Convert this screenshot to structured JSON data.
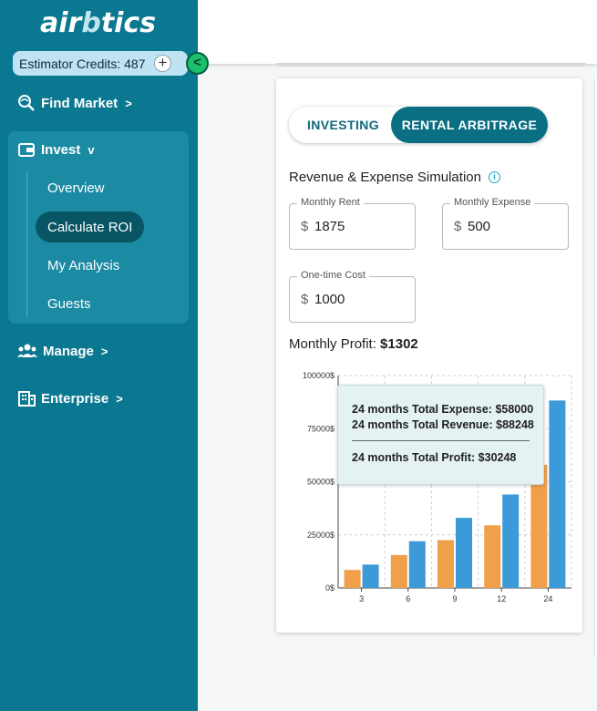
{
  "brand": {
    "logo_prefix": "air",
    "logo_mid": "b",
    "logo_suffix": "tics"
  },
  "credits": {
    "label": "Estimator Credits: 487"
  },
  "sidebar": {
    "find_market": "Find Market",
    "invest": "Invest",
    "invest_items": [
      "Overview",
      "Calculate ROI",
      "My Analysis",
      "Guests"
    ],
    "manage": "Manage",
    "enterprise": "Enterprise"
  },
  "toggle": {
    "investing": "INVESTING",
    "rental": "RENTAL ARBITRAGE"
  },
  "simulation": {
    "title": "Revenue & Expense Simulation",
    "currency": "$",
    "monthly_rent": {
      "label": "Monthly Rent",
      "value": "1875"
    },
    "monthly_expense": {
      "label": "Monthly Expense",
      "value": "500"
    },
    "one_time_cost": {
      "label": "One-time Cost",
      "value": "1000"
    }
  },
  "profit": {
    "label": "Monthly Profit:",
    "value": "$1302"
  },
  "tooltip": {
    "expense": "24 months Total Expense: $58000",
    "revenue": "24 months Total Revenue: $88248",
    "profit": "24 months Total Profit: $30248"
  },
  "colors": {
    "expense": "#f0a04b",
    "revenue": "#3d9ad8",
    "sidebar": "#0b7891",
    "accent": "#0b6f84"
  },
  "chart_data": {
    "type": "bar",
    "categories": [
      "3",
      "6",
      "9",
      "12",
      "24"
    ],
    "series": [
      {
        "name": "",
        "values": [
          8500,
          15500,
          22500,
          29500,
          58000
        ]
      },
      {
        "name": "",
        "values": [
          11000,
          22000,
          33000,
          44000,
          88248
        ]
      }
    ],
    "yticks": [
      "0$",
      "25000$",
      "50000$",
      "75000$",
      "100000$"
    ],
    "ylim": [
      0,
      100000
    ],
    "grid": true
  }
}
